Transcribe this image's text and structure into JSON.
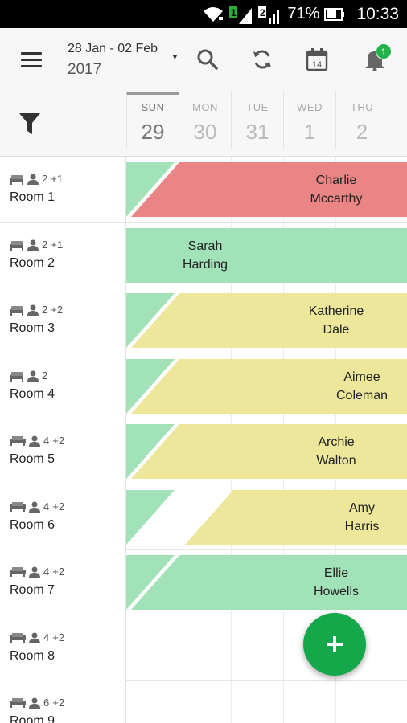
{
  "status_bar": {
    "sim1": "1",
    "sim2": "2",
    "battery": "71%",
    "time": "10:33"
  },
  "toolbar": {
    "date_range": "28 Jan - 02 Feb",
    "year": "2017",
    "notification_count": "1",
    "icons": [
      "menu-icon",
      "search-icon",
      "refresh-icon",
      "calendar-icon",
      "bell-icon"
    ],
    "calendar_day": "14"
  },
  "days": [
    {
      "name": "SUN",
      "num": "29",
      "active": true
    },
    {
      "name": "MON",
      "num": "30"
    },
    {
      "name": "TUE",
      "num": "31"
    },
    {
      "name": "WED",
      "num": "1"
    },
    {
      "name": "THU",
      "num": "2"
    }
  ],
  "rooms": [
    {
      "name": "Room 1",
      "beds": "2",
      "extra": "+1",
      "bed_type": "double"
    },
    {
      "name": "Room 2",
      "beds": "2",
      "extra": "+1",
      "bed_type": "double"
    },
    {
      "name": "Room 3",
      "beds": "2",
      "extra": "+2",
      "bed_type": "double"
    },
    {
      "name": "Room 4",
      "beds": "2",
      "extra": "",
      "bed_type": "double"
    },
    {
      "name": "Room 5",
      "beds": "4",
      "extra": "+2",
      "bed_type": "sofa"
    },
    {
      "name": "Room 6",
      "beds": "4",
      "extra": "+2",
      "bed_type": "sofa"
    },
    {
      "name": "Room 7",
      "beds": "4",
      "extra": "+2",
      "bed_type": "sofa"
    },
    {
      "name": "Room 8",
      "beds": "4",
      "extra": "+2",
      "bed_type": "sofa"
    },
    {
      "name": "Room 9",
      "beds": "6",
      "extra": "+2",
      "bed_type": "sofa"
    }
  ],
  "bookings": [
    {
      "first": "Charlie",
      "last": "Mccarthy",
      "status": "red"
    },
    {
      "first": "Sarah",
      "last": "Harding",
      "status": "green"
    },
    {
      "first": "Katherine",
      "last": "Dale",
      "status": "yellow"
    },
    {
      "first": "Aimee",
      "last": "Coleman",
      "status": "yellow"
    },
    {
      "first": "Archie",
      "last": "Walton",
      "status": "yellow"
    },
    {
      "first": "Amy",
      "last": "Harris",
      "status": "yellow"
    },
    {
      "first": "Ellie",
      "last": "Howells",
      "status": "green"
    }
  ],
  "colors": {
    "green": "#a2e2b8",
    "red": "#e98585",
    "yellow": "#ede79b",
    "fab": "#14a84a",
    "badge": "#22b24c"
  },
  "fab": {
    "icon": "plus-icon"
  }
}
